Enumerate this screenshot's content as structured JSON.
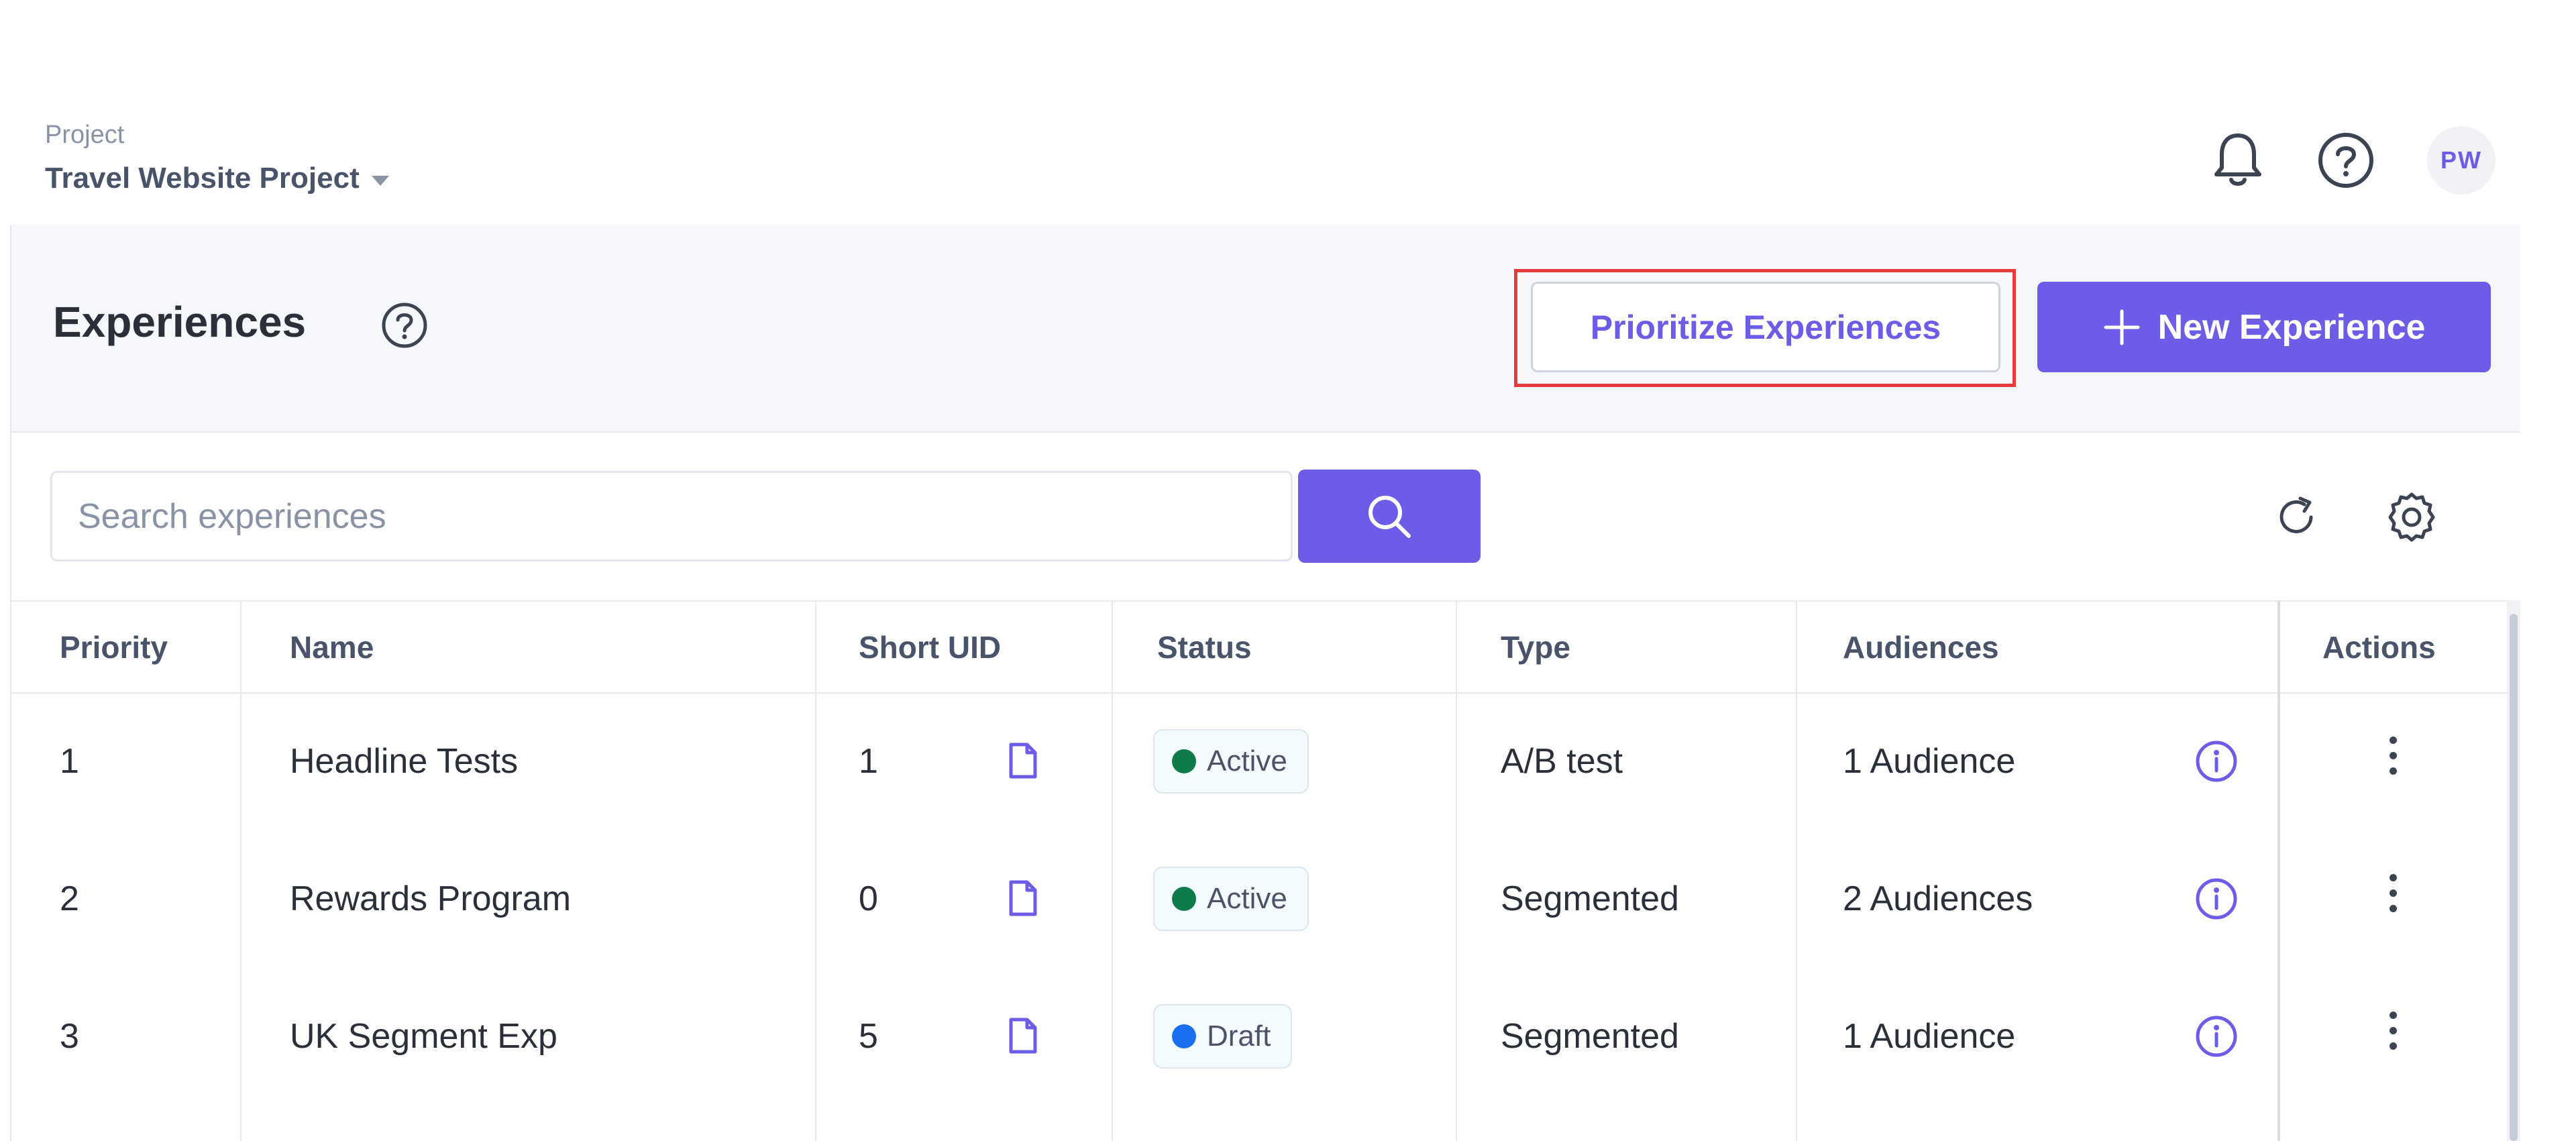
{
  "project": {
    "label": "Project",
    "name": "Travel Website Project"
  },
  "header": {
    "notification_icon": "bell-icon",
    "help_icon": "question-circle-icon",
    "avatar_initials": "PW"
  },
  "page": {
    "title": "Experiences",
    "prioritize_label": "Prioritize Experiences",
    "new_label": "New Experience"
  },
  "search": {
    "placeholder": "Search experiences",
    "value": ""
  },
  "table": {
    "columns": {
      "priority": "Priority",
      "name": "Name",
      "short_uid": "Short UID",
      "status": "Status",
      "type": "Type",
      "audiences": "Audiences",
      "actions": "Actions"
    },
    "rows": [
      {
        "priority": "1",
        "name": "Headline Tests",
        "uid": "1",
        "status": "Active",
        "type": "A/B test",
        "audiences": "1 Audience"
      },
      {
        "priority": "2",
        "name": "Rewards Program",
        "uid": "0",
        "status": "Active",
        "type": "Segmented",
        "audiences": "2 Audiences"
      },
      {
        "priority": "3",
        "name": "UK Segment Exp",
        "uid": "5",
        "status": "Draft",
        "type": "Segmented",
        "audiences": "1 Audience"
      }
    ]
  },
  "colors": {
    "accent": "#6c5ce7",
    "active_dot": "#0f7a4a",
    "draft_dot": "#1a6ff0",
    "highlight_frame": "#e53b3b"
  }
}
